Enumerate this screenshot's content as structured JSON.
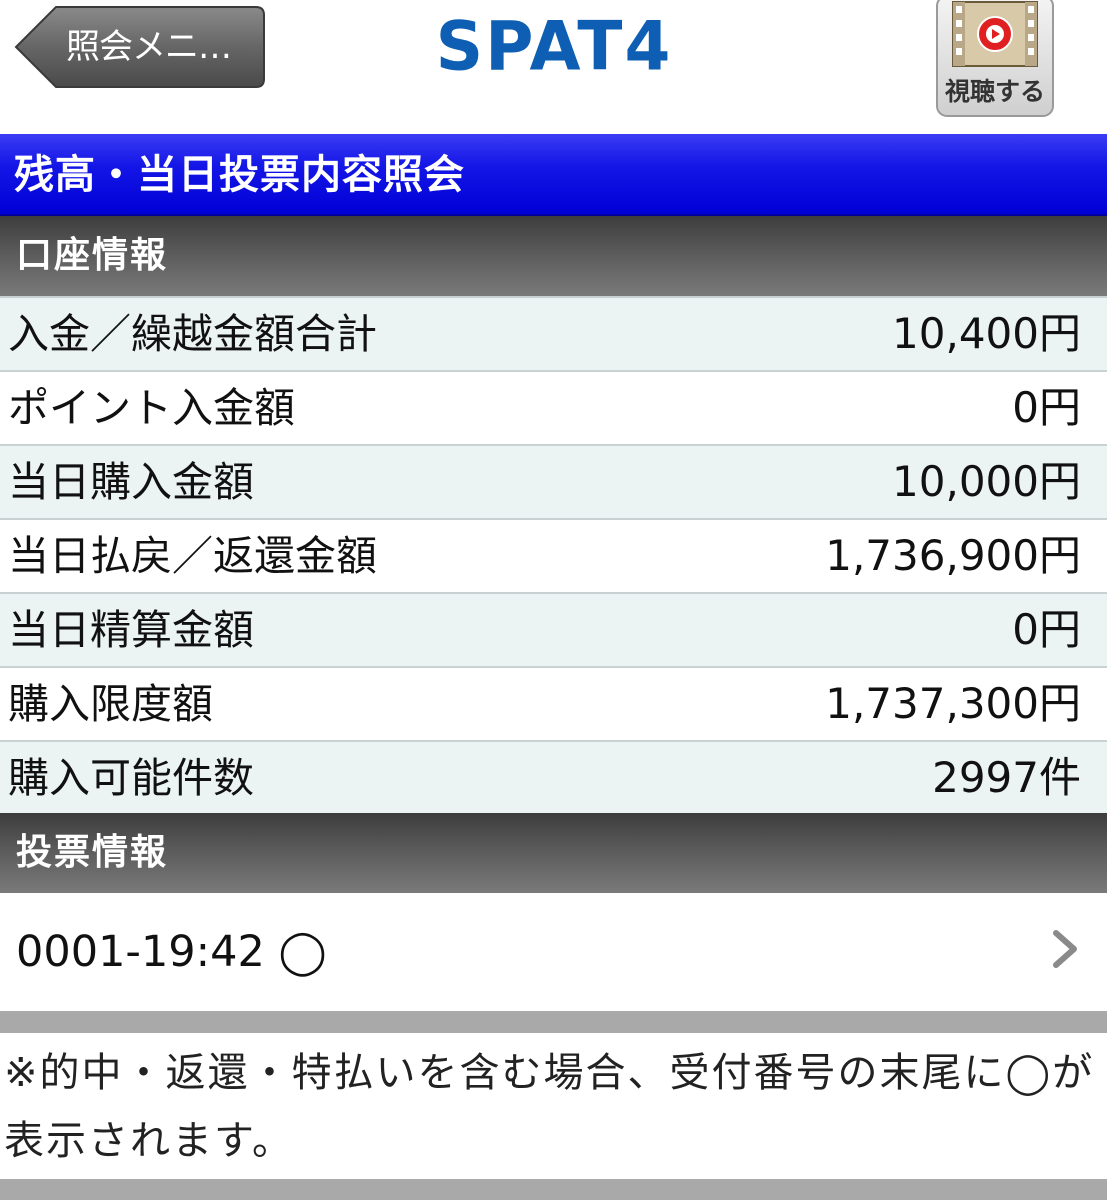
{
  "header": {
    "back_label": "照会メニ…",
    "logo_text": "SPAT4",
    "watch_label": "視聴する"
  },
  "title": "残高・当日投票内容照会",
  "account_section": {
    "heading": "口座情報",
    "rows": [
      {
        "label": "入金／繰越金額合計",
        "value": "10,400円"
      },
      {
        "label": "ポイント入金額",
        "value": "0円"
      },
      {
        "label": "当日購入金額",
        "value": "10,000円"
      },
      {
        "label": "当日払戻／返還金額",
        "value": "1,736,900円"
      },
      {
        "label": "当日精算金額",
        "value": "0円"
      },
      {
        "label": "購入限度額",
        "value": "1,737,300円"
      },
      {
        "label": "購入可能件数",
        "value": "2997件"
      }
    ]
  },
  "vote_section": {
    "heading": "投票情報",
    "entries": [
      {
        "text": "0001-19:42 ◯"
      }
    ],
    "note": "※的中・返還・特払いを含む場合、受付番号の末尾に◯が表示されます。"
  },
  "colors": {
    "title_bar": "#1416e6",
    "logo": "#0e5fb4",
    "section_header": "#5a5a5a",
    "row_alt": "#ecf3f3"
  },
  "icons": {
    "back": "left-arrow-button-icon",
    "watch": "film-play-icon",
    "chevron": "chevron-right-icon"
  }
}
